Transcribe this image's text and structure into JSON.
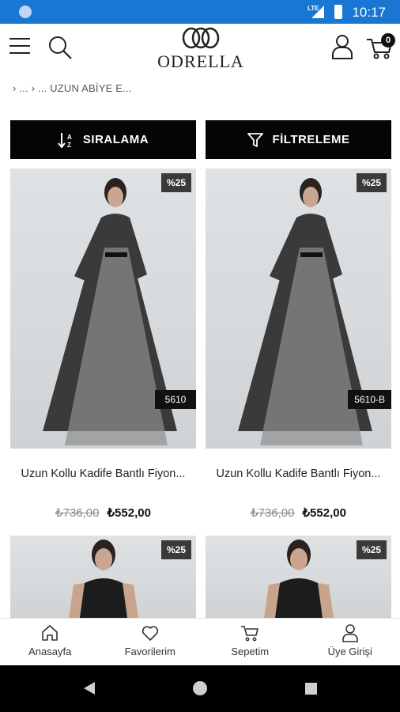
{
  "status_bar": {
    "time": "10:17",
    "network": "LTE"
  },
  "header": {
    "logo_text": "ODRELLA",
    "cart_count": "0"
  },
  "breadcrumb": "› ... › ... UZUN ABİYE E...",
  "toolbar": {
    "sort_label": "SIRALAMA",
    "filter_label": "FİLTRELEME"
  },
  "products": [
    {
      "discount": "%25",
      "code": "5610",
      "title": "Uzun Kollu Kadife Bantlı Fiyon...",
      "old_price": "₺736,00",
      "price": "₺552,00"
    },
    {
      "discount": "%25",
      "code": "5610-B",
      "title": "Uzun Kollu Kadife Bantlı Fiyon...",
      "old_price": "₺736,00",
      "price": "₺552,00"
    },
    {
      "discount": "%25"
    },
    {
      "discount": "%25"
    }
  ],
  "tabs": [
    {
      "label": "Anasayfa",
      "icon": "home-icon"
    },
    {
      "label": "Favorilerim",
      "icon": "heart-icon"
    },
    {
      "label": "Sepetim",
      "icon": "cart-icon"
    },
    {
      "label": "Üye Girişi",
      "icon": "user-icon"
    }
  ]
}
